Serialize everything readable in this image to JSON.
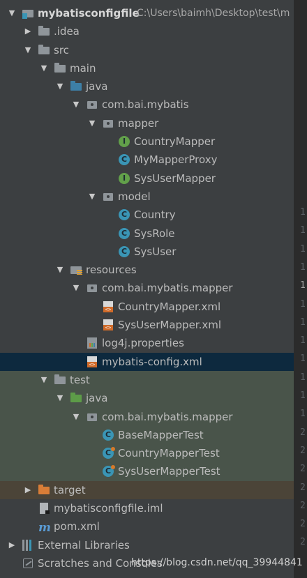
{
  "project": {
    "name": "mybatisconfigfile",
    "path": "C:\\Users\\baimh\\Desktop\\test\\m"
  },
  "tree": [
    {
      "id": "root",
      "label": "mybatisconfigfile",
      "arrow": "down",
      "icon": "module-folder-icon",
      "indent": 0
    },
    {
      "id": "idea",
      "label": ".idea",
      "arrow": "right",
      "icon": "folder-icon",
      "indent": 1
    },
    {
      "id": "src",
      "label": "src",
      "arrow": "down",
      "icon": "folder-icon",
      "indent": 1
    },
    {
      "id": "main",
      "label": "main",
      "arrow": "down",
      "icon": "folder-icon",
      "indent": 2
    },
    {
      "id": "main-java",
      "label": "java",
      "arrow": "down",
      "icon": "source-folder-icon",
      "indent": 3
    },
    {
      "id": "pkg-mybatis",
      "label": "com.bai.mybatis",
      "arrow": "down",
      "icon": "package-icon",
      "indent": 4
    },
    {
      "id": "pkg-mapper",
      "label": "mapper",
      "arrow": "down",
      "icon": "package-icon",
      "indent": 5
    },
    {
      "id": "CountryMapper",
      "label": "CountryMapper",
      "arrow": "",
      "icon": "interface-icon",
      "indent": 6
    },
    {
      "id": "MyMapperProxy",
      "label": "MyMapperProxy",
      "arrow": "",
      "icon": "class-icon",
      "indent": 6
    },
    {
      "id": "SysUserMapper",
      "label": "SysUserMapper",
      "arrow": "",
      "icon": "interface-icon",
      "indent": 6
    },
    {
      "id": "pkg-model",
      "label": "model",
      "arrow": "down",
      "icon": "package-icon",
      "indent": 5
    },
    {
      "id": "Country",
      "label": "Country",
      "arrow": "",
      "icon": "class-icon",
      "indent": 6
    },
    {
      "id": "SysRole",
      "label": "SysRole",
      "arrow": "",
      "icon": "class-icon",
      "indent": 6
    },
    {
      "id": "SysUser",
      "label": "SysUser",
      "arrow": "",
      "icon": "class-icon",
      "indent": 6
    },
    {
      "id": "resources",
      "label": "resources",
      "arrow": "down",
      "icon": "resources-folder-icon",
      "indent": 3
    },
    {
      "id": "res-pkg",
      "label": "com.bai.mybatis.mapper",
      "arrow": "down",
      "icon": "package-icon",
      "indent": 4
    },
    {
      "id": "CountryMapperXml",
      "label": "CountryMapper.xml",
      "arrow": "",
      "icon": "xml-file-icon",
      "indent": 5
    },
    {
      "id": "SysUserMapperXml",
      "label": "SysUserMapper.xml",
      "arrow": "",
      "icon": "xml-file-icon",
      "indent": 5
    },
    {
      "id": "log4j",
      "label": "log4j.properties",
      "arrow": "",
      "icon": "properties-file-icon",
      "indent": 4
    },
    {
      "id": "mybatisConfig",
      "label": "mybatis-config.xml",
      "arrow": "",
      "icon": "xml-file-icon",
      "indent": 4,
      "selected": true
    },
    {
      "id": "test",
      "label": "test",
      "arrow": "down",
      "icon": "folder-icon",
      "indent": 2,
      "zone": "test"
    },
    {
      "id": "test-java",
      "label": "java",
      "arrow": "down",
      "icon": "test-folder-icon",
      "indent": 3,
      "zone": "test"
    },
    {
      "id": "test-pkg",
      "label": "com.bai.mybatis.mapper",
      "arrow": "down",
      "icon": "package-icon",
      "indent": 4,
      "zone": "test"
    },
    {
      "id": "BaseMapperTest",
      "label": "BaseMapperTest",
      "arrow": "",
      "icon": "class-icon",
      "indent": 5,
      "zone": "test"
    },
    {
      "id": "CountryMapperTest",
      "label": "CountryMapperTest",
      "arrow": "",
      "icon": "test-class-icon",
      "indent": 5,
      "zone": "test"
    },
    {
      "id": "SysUserMapperTest",
      "label": "SysUserMapperTest",
      "arrow": "",
      "icon": "test-class-icon",
      "indent": 5,
      "zone": "test"
    },
    {
      "id": "target",
      "label": "target",
      "arrow": "right",
      "icon": "excluded-folder-icon",
      "indent": 1,
      "zone": "excluded"
    },
    {
      "id": "iml",
      "label": "mybatisconfigfile.iml",
      "arrow": "",
      "icon": "iml-file-icon",
      "indent": 1
    },
    {
      "id": "pom",
      "label": "pom.xml",
      "arrow": "",
      "icon": "maven-icon",
      "indent": 1
    },
    {
      "id": "extlibs",
      "label": "External Libraries",
      "arrow": "right",
      "icon": "libraries-icon",
      "indent": 0
    },
    {
      "id": "scratches",
      "label": "Scratches and Consoles",
      "arrow": "",
      "icon": "scratches-icon",
      "indent": 0
    }
  ],
  "gutter": [
    "1",
    "1",
    "1",
    "1",
    "1",
    "1",
    "1",
    "1",
    "1",
    "1",
    "1",
    "1",
    "2",
    "2",
    "2",
    "2",
    "2",
    "2",
    "2"
  ],
  "watermark": "https://blog.csdn.net/qq_39944841"
}
